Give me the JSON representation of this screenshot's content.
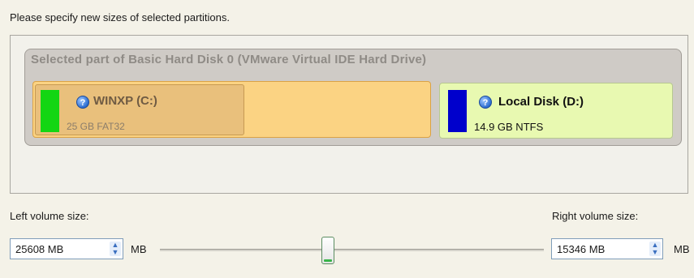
{
  "instruction": "Please specify new sizes of selected partitions.",
  "disk": {
    "title": "Selected part of Basic Hard Disk 0 (VMware Virtual IDE Hard Drive)",
    "partitions": [
      {
        "label": "WINXP (C:)",
        "detail": "25 GB FAT32",
        "color": "#13d613"
      },
      {
        "label": "Local Disk (D:)",
        "detail": "14.9 GB NTFS",
        "color": "#0000cc"
      }
    ]
  },
  "resize": {
    "left_label": "Left volume size:",
    "right_label": "Right volume size:",
    "left_value": "25608 MB",
    "right_value": "15346 MB",
    "unit": "MB",
    "slider_fraction": 0.4254
  },
  "icons": {
    "help": "help-icon",
    "spinner": "spin-updown-icon",
    "slider_thumb": "slider-thumb"
  },
  "colors": {
    "panel_background": "#f2f1eb",
    "selected_region": "#fbd383",
    "partition_d": "#e8f9b1"
  }
}
